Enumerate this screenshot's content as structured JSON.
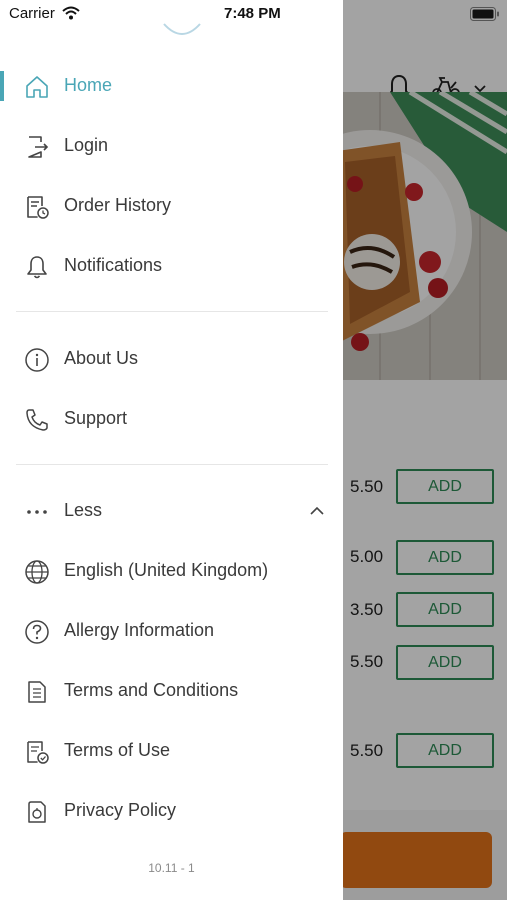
{
  "status_bar": {
    "carrier": "Carrier",
    "time": "7:48 PM"
  },
  "drawer": {
    "items_primary": [
      {
        "label": "Home",
        "icon": "home-icon",
        "active": true
      },
      {
        "label": "Login",
        "icon": "login-icon"
      },
      {
        "label": "Order History",
        "icon": "order-history-icon"
      },
      {
        "label": "Notifications",
        "icon": "bell-icon"
      }
    ],
    "items_secondary": [
      {
        "label": "About Us",
        "icon": "info-icon"
      },
      {
        "label": "Support",
        "icon": "phone-icon"
      }
    ],
    "less_label": "Less",
    "items_more": [
      {
        "label": "English (United Kingdom)",
        "icon": "globe-icon"
      },
      {
        "label": "Allergy Information",
        "icon": "question-icon"
      },
      {
        "label": "Terms and Conditions",
        "icon": "document-icon"
      },
      {
        "label": "Terms of Use",
        "icon": "document-check-icon"
      },
      {
        "label": "Privacy Policy",
        "icon": "privacy-icon"
      }
    ],
    "version": "10.11 - 1",
    "accent_color": "#4aa6b6"
  },
  "background": {
    "menu_rows": [
      {
        "price": "5.50",
        "add_label": "ADD"
      },
      {
        "price": "5.00",
        "add_label": "ADD"
      },
      {
        "price": "3.50",
        "add_label": "ADD"
      },
      {
        "price": "5.50",
        "add_label": "ADD"
      },
      {
        "price": "5.50",
        "add_label": "ADD"
      }
    ],
    "add_color": "#2e8b57",
    "cart_color": "#e37219"
  }
}
